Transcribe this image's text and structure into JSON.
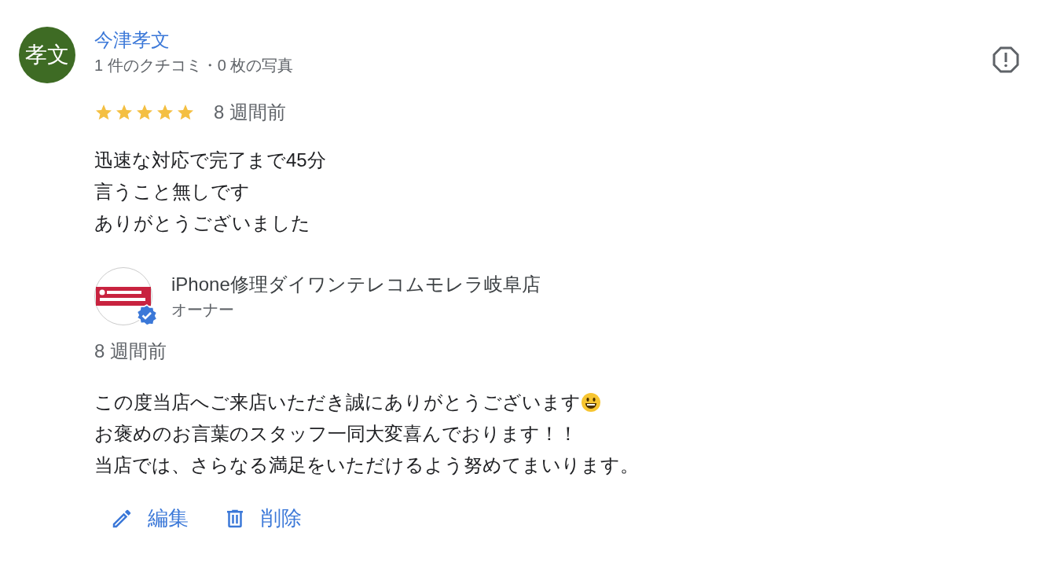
{
  "review": {
    "avatar_text": "孝文",
    "author": "今津孝文",
    "meta": "1 件のクチコミ・0 枚の写真",
    "stars": 5,
    "time": "8 週間前",
    "lines": [
      "迅速な対応で完了まで45分",
      "言うこと無しです",
      "ありがとうございました"
    ]
  },
  "reply": {
    "verified": true,
    "owner_name": "iPhone修理ダイワンテレコムモレラ岐阜店",
    "role": "オーナー",
    "time": "8 週間前",
    "lines": [
      {
        "text": "この度当店へご来店いただき誠にありがとうございます",
        "smiley": true
      },
      {
        "text": "お褒めのお言葉のスタッフ一同大変喜んでおります！！",
        "smiley": false
      },
      {
        "text": "当店では、さらなる満足をいただけるよう努めてまいります。",
        "smiley": false
      }
    ]
  },
  "actions": [
    {
      "kind": "edit",
      "label": "編集"
    },
    {
      "kind": "delete",
      "label": "削除"
    }
  ]
}
